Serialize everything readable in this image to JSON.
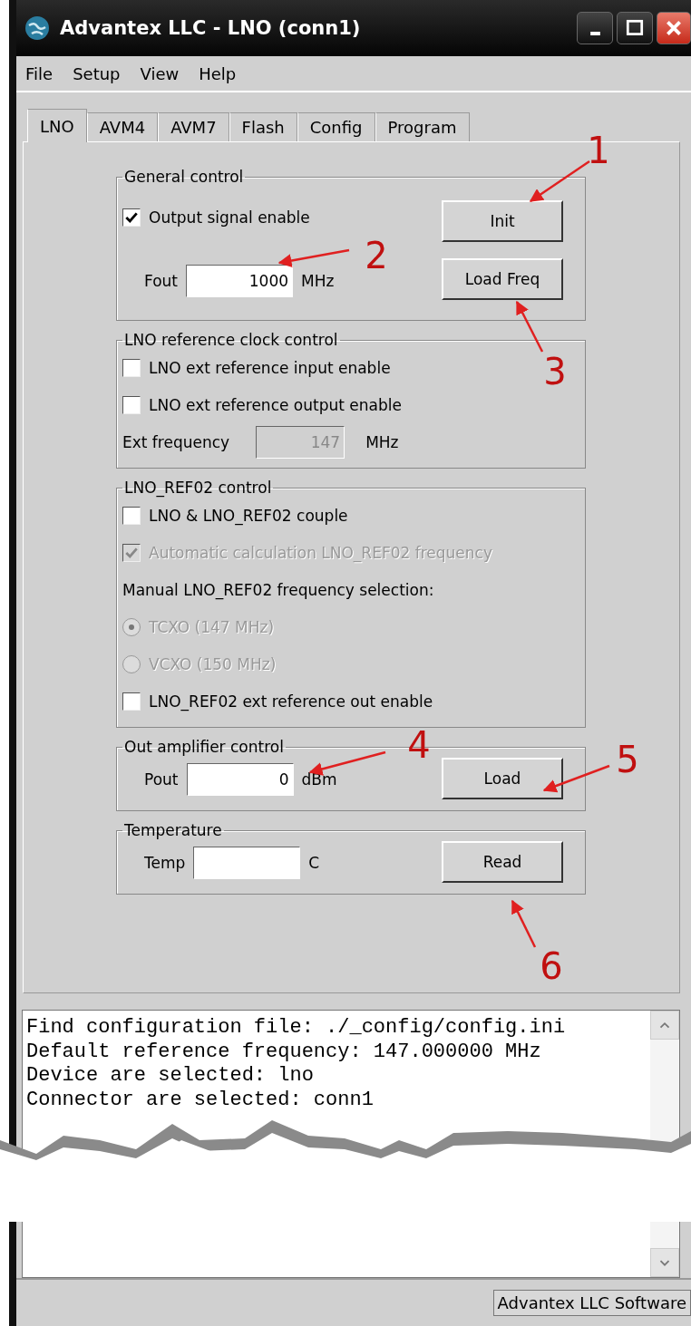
{
  "window": {
    "title": "Advantex LLC - LNO (conn1)"
  },
  "menu": [
    "File",
    "Setup",
    "View",
    "Help"
  ],
  "tabs": [
    {
      "label": "LNO",
      "selected": true
    },
    {
      "label": "AVM4",
      "selected": false
    },
    {
      "label": "AVM7",
      "selected": false
    },
    {
      "label": "Flash",
      "selected": false
    },
    {
      "label": "Config",
      "selected": false
    },
    {
      "label": "Program",
      "selected": false
    }
  ],
  "groups": [
    {
      "title": "General control",
      "rows": [
        {
          "kind": "checkbox",
          "label": "Output signal enable",
          "checked": true,
          "disabled": false
        },
        {
          "kind": "field",
          "label": "Fout",
          "value": "1000",
          "unit": "MHz",
          "disabled": false
        }
      ],
      "buttons": [
        "Init",
        "Load Freq"
      ]
    },
    {
      "title": "LNO reference clock control",
      "rows": [
        {
          "kind": "checkbox",
          "label": "LNO ext reference input enable",
          "checked": false,
          "disabled": false
        },
        {
          "kind": "checkbox",
          "label": "LNO ext reference output enable",
          "checked": false,
          "disabled": false
        },
        {
          "kind": "field",
          "label": "Ext frequency",
          "value": "147",
          "unit": "MHz",
          "disabled": true
        }
      ]
    },
    {
      "title": "LNO_REF02 control",
      "rows": [
        {
          "kind": "checkbox",
          "label": "LNO & LNO_REF02 couple",
          "checked": false,
          "disabled": false
        },
        {
          "kind": "checkbox",
          "label": "Automatic calculation LNO_REF02 frequency",
          "checked": true,
          "disabled": true
        },
        {
          "kind": "text",
          "label": "Manual LNO_REF02 frequency selection:"
        },
        {
          "kind": "radio",
          "label": "TCXO (147 MHz)",
          "selected": true,
          "disabled": true
        },
        {
          "kind": "radio",
          "label": "VCXO (150 MHz)",
          "selected": false,
          "disabled": true
        },
        {
          "kind": "checkbox",
          "label": "LNO_REF02 ext reference out enable",
          "checked": false,
          "disabled": false
        }
      ]
    },
    {
      "title": "Out amplifier control",
      "rows": [
        {
          "kind": "field",
          "label": "Pout",
          "value": "0",
          "unit": "dBm",
          "disabled": false
        }
      ],
      "buttons": [
        "Load"
      ]
    },
    {
      "title": "Temperature",
      "rows": [
        {
          "kind": "field",
          "label": "Temp",
          "value": "",
          "unit": "C",
          "disabled": false
        }
      ],
      "buttons": [
        "Read"
      ]
    }
  ],
  "log": [
    "Find configuration file: ./_config/config.ini",
    "Default reference frequency: 147.000000 MHz",
    "Device are selected: lno",
    "Connector are selected: conn1"
  ],
  "status_bar": "Advantex LLC Software",
  "annotations": [
    "1",
    "2",
    "3",
    "4",
    "5",
    "6"
  ]
}
